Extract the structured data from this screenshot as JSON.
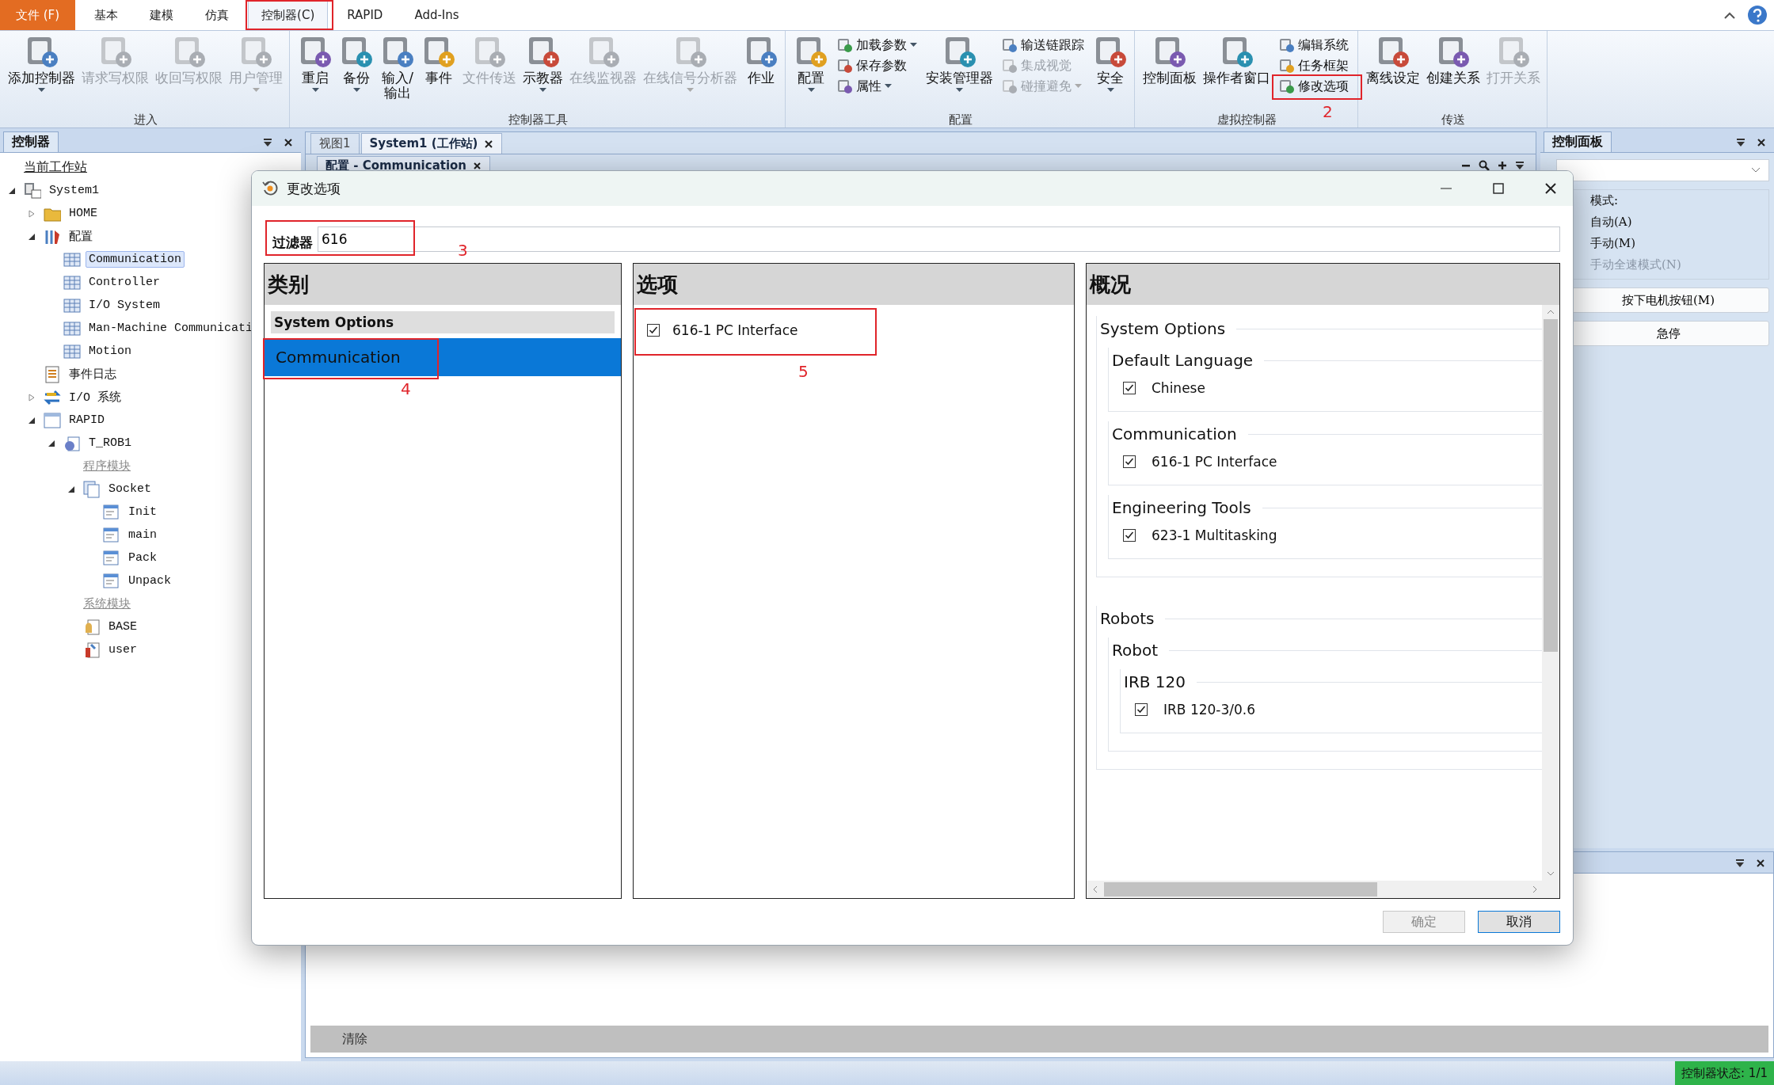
{
  "menu_tabs": [
    {
      "label": "文件 (F)",
      "kind": "file",
      "selected": false,
      "highlighted": false
    },
    {
      "label": "基本",
      "kind": "tab",
      "selected": false,
      "highlighted": false
    },
    {
      "label": "建模",
      "kind": "tab",
      "selected": false,
      "highlighted": false
    },
    {
      "label": "仿真",
      "kind": "tab",
      "selected": false,
      "highlighted": false
    },
    {
      "label": "控制器(C)",
      "kind": "tab",
      "selected": true,
      "highlighted": true
    },
    {
      "label": "RAPID",
      "kind": "tab",
      "selected": false,
      "highlighted": false
    },
    {
      "label": "Add-Ins",
      "kind": "tab",
      "selected": false,
      "highlighted": false
    }
  ],
  "ribbon": {
    "groups": [
      {
        "title": "进入",
        "items": [
          {
            "kind": "large",
            "label": "添加控制器",
            "disabled": false,
            "dropdown": true
          },
          {
            "kind": "large",
            "label": "请求写权限",
            "disabled": true,
            "dropdown": false
          },
          {
            "kind": "large",
            "label": "收回写权限",
            "disabled": true,
            "dropdown": false
          },
          {
            "kind": "large",
            "label": "用户管理",
            "disabled": true,
            "dropdown": true
          }
        ]
      },
      {
        "title": "控制器工具",
        "items": [
          {
            "kind": "large",
            "label": "重启",
            "disabled": false,
            "dropdown": true
          },
          {
            "kind": "large",
            "label": "备份",
            "disabled": false,
            "dropdown": true
          },
          {
            "kind": "large",
            "label": "输入/\n输出",
            "disabled": false,
            "dropdown": false
          },
          {
            "kind": "large",
            "label": "事件",
            "disabled": false,
            "dropdown": false
          },
          {
            "kind": "large",
            "label": "文件传送",
            "disabled": true,
            "dropdown": false
          },
          {
            "kind": "large",
            "label": "示教器",
            "disabled": false,
            "dropdown": true
          },
          {
            "kind": "large",
            "label": "在线监视器",
            "disabled": true,
            "dropdown": false
          },
          {
            "kind": "large",
            "label": "在线信号分析器",
            "disabled": true,
            "dropdown": true
          },
          {
            "kind": "large",
            "label": "作业",
            "disabled": false,
            "dropdown": false
          }
        ]
      },
      {
        "title": "配置",
        "items": [
          {
            "kind": "large",
            "label": "配置",
            "disabled": false,
            "dropdown": true
          },
          {
            "kind": "stack",
            "items": [
              {
                "label": "加载参数",
                "disabled": false,
                "dropdown": true
              },
              {
                "label": "保存参数",
                "disabled": false,
                "dropdown": false
              },
              {
                "label": "属性",
                "disabled": false,
                "dropdown": true
              }
            ]
          },
          {
            "kind": "large",
            "label": "安装管理器",
            "disabled": false,
            "dropdown": true
          },
          {
            "kind": "stack",
            "items": [
              {
                "label": "输送链跟踪",
                "disabled": false,
                "dropdown": false
              },
              {
                "label": "集成视觉",
                "disabled": true,
                "dropdown": false
              },
              {
                "label": "碰撞避免",
                "disabled": true,
                "dropdown": true
              }
            ]
          },
          {
            "kind": "large",
            "label": "安全",
            "disabled": false,
            "dropdown": true
          }
        ]
      },
      {
        "title": "虚拟控制器",
        "items": [
          {
            "kind": "large",
            "label": "控制面板",
            "disabled": false,
            "dropdown": false
          },
          {
            "kind": "large",
            "label": "操作者窗口",
            "disabled": false,
            "dropdown": false
          },
          {
            "kind": "stack",
            "items": [
              {
                "label": "编辑系统",
                "disabled": false,
                "dropdown": false
              },
              {
                "label": "任务框架",
                "disabled": false,
                "dropdown": false
              },
              {
                "label": "修改选项",
                "disabled": false,
                "dropdown": false,
                "callout": "2"
              }
            ]
          }
        ]
      },
      {
        "title": "传送",
        "items": [
          {
            "kind": "large",
            "label": "离线设定",
            "disabled": false,
            "dropdown": false
          },
          {
            "kind": "large",
            "label": "创建关系",
            "disabled": false,
            "dropdown": false
          },
          {
            "kind": "large",
            "label": "打开关系",
            "disabled": true,
            "dropdown": false
          }
        ]
      }
    ]
  },
  "controller_panel": {
    "title": "控制器",
    "tree": [
      {
        "kind": "link",
        "label": "当前工作站"
      },
      {
        "kind": "system",
        "label": "System1",
        "expanded": true,
        "selected": false,
        "children": [
          {
            "kind": "folder",
            "label": "HOME",
            "expanded": false,
            "selected": false
          },
          {
            "kind": "config",
            "label": "配置",
            "expanded": true,
            "selected": false,
            "children": [
              {
                "kind": "table",
                "label": "Communication",
                "selected": true
              },
              {
                "kind": "table",
                "label": "Controller",
                "selected": false
              },
              {
                "kind": "table",
                "label": "I/O System",
                "selected": false
              },
              {
                "kind": "table",
                "label": "Man-Machine Communicati",
                "selected": false
              },
              {
                "kind": "table",
                "label": "Motion",
                "selected": false
              }
            ]
          },
          {
            "kind": "log",
            "label": "事件日志",
            "selected": false
          },
          {
            "kind": "io",
            "label": "I/O 系统",
            "expanded": false,
            "selected": false
          },
          {
            "kind": "rapid",
            "label": "RAPID",
            "expanded": true,
            "selected": false,
            "children": [
              {
                "kind": "task",
                "label": "T_ROB1",
                "expanded": true,
                "selected": false,
                "children": [
                  {
                    "kind": "section",
                    "label": "程序模块"
                  },
                  {
                    "kind": "module",
                    "label": "Socket",
                    "expanded": true,
                    "selected": false,
                    "children": [
                      {
                        "kind": "routine",
                        "label": "Init",
                        "selected": false
                      },
                      {
                        "kind": "routine",
                        "label": "main",
                        "selected": false
                      },
                      {
                        "kind": "routine",
                        "label": "Pack",
                        "selected": false
                      },
                      {
                        "kind": "routine",
                        "label": "Unpack",
                        "selected": false
                      }
                    ]
                  },
                  {
                    "kind": "section",
                    "label": "系统模块"
                  },
                  {
                    "kind": "sysmodule",
                    "label": "BASE",
                    "selected": false
                  },
                  {
                    "kind": "usermodule",
                    "label": "user",
                    "selected": false
                  }
                ]
              }
            ]
          }
        ]
      }
    ]
  },
  "document": {
    "tabs": [
      {
        "label": "视图1",
        "selected": false,
        "closable": false
      },
      {
        "label": "System1 (工作站)",
        "selected": true,
        "closable": true
      }
    ],
    "sub_tabs": [
      {
        "label": "配置 - Communication",
        "selected": true,
        "closable": true
      }
    ]
  },
  "control_panel": {
    "title": "控制面板",
    "mode_label": "模式:",
    "modes": [
      {
        "label": "自动(A)",
        "disabled": false
      },
      {
        "label": "手动(M)",
        "disabled": false
      },
      {
        "label": "手动全速模式(N)",
        "disabled": true
      }
    ],
    "buttons": [
      "按下电机按钮(M)",
      "急停"
    ]
  },
  "output_panel": {
    "clear_button": "清除"
  },
  "status_bar": {
    "controller_status": "控制器状态: 1/1"
  },
  "dialog": {
    "title": "更改选项",
    "filter": {
      "label": "过滤器",
      "value": "616",
      "callout": "3"
    },
    "categories": {
      "title": "类别",
      "groups": [
        {
          "label": "System Options",
          "items": [
            {
              "label": "Communication",
              "selected": true,
              "callout": "4"
            }
          ]
        }
      ]
    },
    "options": {
      "title": "选项",
      "items": [
        {
          "label": "616-1 PC Interface",
          "checked": true,
          "callout": "5"
        }
      ]
    },
    "overview": {
      "title": "概况",
      "groups": [
        {
          "label": "System Options",
          "children": [
            {
              "label": "Default Language",
              "children": [
                {
                  "label": "Chinese",
                  "checked": true
                }
              ]
            },
            {
              "label": "Communication",
              "children": [
                {
                  "label": "616-1 PC Interface",
                  "checked": true
                }
              ]
            },
            {
              "label": "Engineering Tools",
              "children": [
                {
                  "label": "623-1 Multitasking",
                  "checked": true
                }
              ]
            }
          ]
        },
        {
          "label": "Robots",
          "children": [
            {
              "label": "Robot",
              "children": [
                {
                  "label": "IRB 120",
                  "children": [
                    {
                      "label": "IRB 120-3/0.6",
                      "checked": true
                    }
                  ]
                }
              ]
            }
          ]
        }
      ]
    },
    "buttons": [
      {
        "label": "确定",
        "disabled": true
      },
      {
        "label": "取消",
        "disabled": false
      }
    ]
  }
}
